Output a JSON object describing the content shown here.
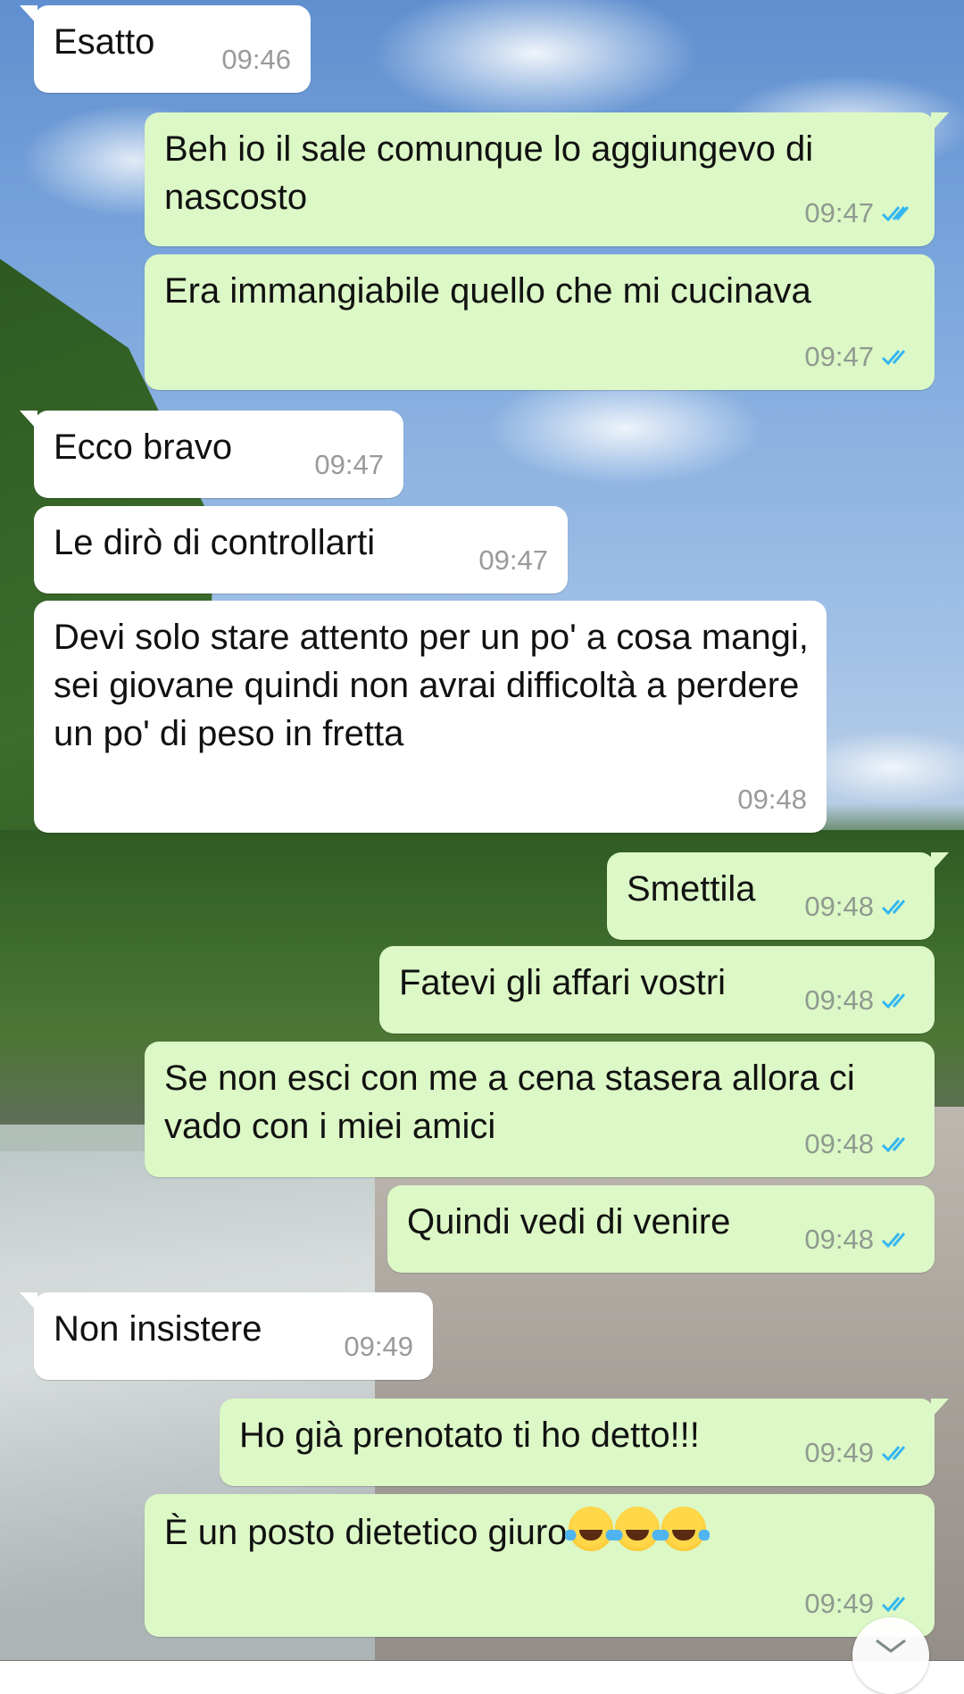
{
  "colors": {
    "incoming_bubble": "#ffffff",
    "outgoing_bubble": "#dcf8c6",
    "read_ticks": "#34b7f1"
  },
  "messages": [
    {
      "direction": "in",
      "text": "Esatto",
      "time": "09:46"
    },
    {
      "direction": "out",
      "text": "Beh io il sale comunque lo aggiungevo di nascosto",
      "time": "09:47",
      "read": true
    },
    {
      "direction": "out",
      "text": "Era immangiabile quello che mi cucinava",
      "time": "09:47",
      "read": true
    },
    {
      "direction": "in",
      "text": "Ecco bravo",
      "time": "09:47"
    },
    {
      "direction": "in",
      "text": "Le dirò di controllarti",
      "time": "09:47"
    },
    {
      "direction": "in",
      "text": "Devi solo stare attento per un po' a cosa mangi, sei giovane quindi non avrai difficoltà a perdere un po' di peso in fretta",
      "time": "09:48"
    },
    {
      "direction": "out",
      "text": "Smettila",
      "time": "09:48",
      "read": true
    },
    {
      "direction": "out",
      "text": "Fatevi gli affari vostri",
      "time": "09:48",
      "read": true
    },
    {
      "direction": "out",
      "text": "Se non esci con me a cena stasera allora ci vado con i miei amici",
      "time": "09:48",
      "read": true
    },
    {
      "direction": "out",
      "text": "Quindi vedi di venire",
      "time": "09:48",
      "read": true
    },
    {
      "direction": "in",
      "text": "Non insistere",
      "time": "09:49"
    },
    {
      "direction": "out",
      "text": "Ho già prenotato ti ho detto!!!",
      "time": "09:49",
      "read": true
    },
    {
      "direction": "out",
      "text": "È un posto dietetico giuro",
      "time": "09:49",
      "read": true,
      "emojis": [
        "face-with-tears-of-joy",
        "face-with-tears-of-joy",
        "face-with-tears-of-joy"
      ]
    }
  ],
  "icons": {
    "ticks": "double-check-icon",
    "scroll": "chevron-down-icon"
  }
}
